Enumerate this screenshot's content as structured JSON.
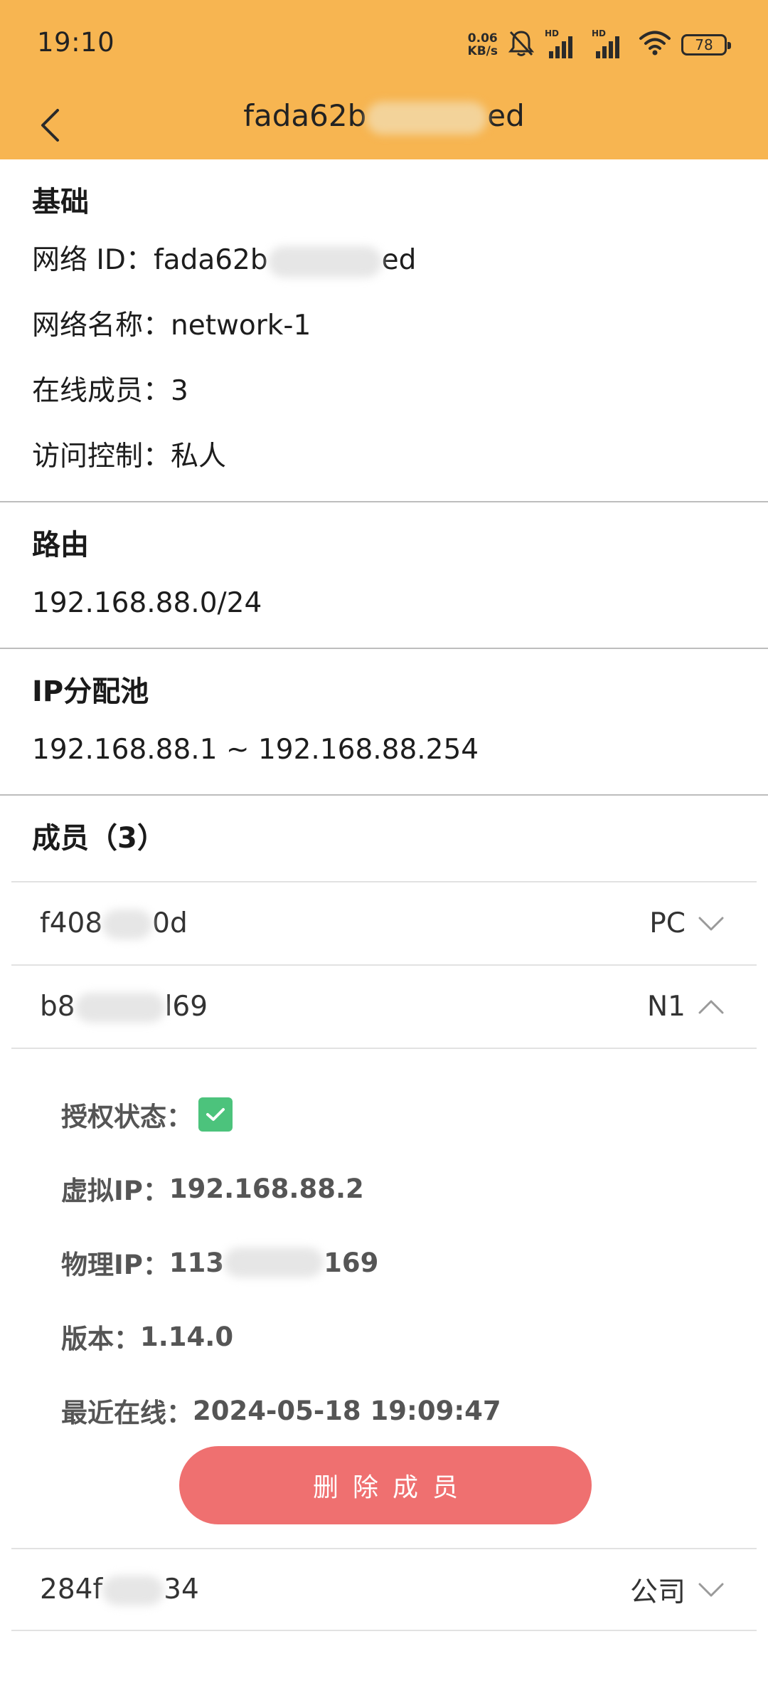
{
  "status_bar": {
    "time": "19:10",
    "net_speed_value": "0.06",
    "net_speed_unit": "KB/s",
    "sim1_label": "HD",
    "sim2_label": "HD",
    "battery_level": "78"
  },
  "app_bar": {
    "title_prefix": "fada62b",
    "title_suffix": "ed"
  },
  "basic": {
    "title": "基础",
    "network_id_label": "网络 ID：",
    "network_id_prefix": "fada62b",
    "network_id_suffix": "ed",
    "network_name_label": "网络名称：",
    "network_name": "network-1",
    "online_members_label": "在线成员：",
    "online_members": "3",
    "access_control_label": "访问控制：",
    "access_control": "私人"
  },
  "route": {
    "title": "路由",
    "value": "192.168.88.0/24"
  },
  "ip_pool": {
    "title": "IP分配池",
    "value": "192.168.88.1 ~ 192.168.88.254"
  },
  "members": {
    "title": "成员（3）",
    "items": [
      {
        "id_prefix": "f408",
        "id_suffix": "0d",
        "name": "PC",
        "expanded": false
      },
      {
        "id_prefix": "b8",
        "id_suffix": "l69",
        "name": "N1",
        "expanded": true
      },
      {
        "id_prefix": "284f",
        "id_suffix": "34",
        "name": "公司",
        "expanded": false
      }
    ],
    "detail": {
      "auth_label": "授权状态：",
      "auth_checked": true,
      "virtual_ip_label": "虚拟IP：",
      "virtual_ip": "192.168.88.2",
      "physical_ip_label": "物理IP：",
      "physical_ip_prefix": "113",
      "physical_ip_suffix": "169",
      "version_label": "版本：",
      "version": "1.14.0",
      "last_online_label": "最近在线：",
      "last_online": "2024-05-18 19:09:47",
      "delete_button": "删除成员"
    }
  },
  "colors": {
    "app_bar": "#F7B551",
    "delete_button": "#EF7070",
    "checkbox": "#4CC37C"
  }
}
